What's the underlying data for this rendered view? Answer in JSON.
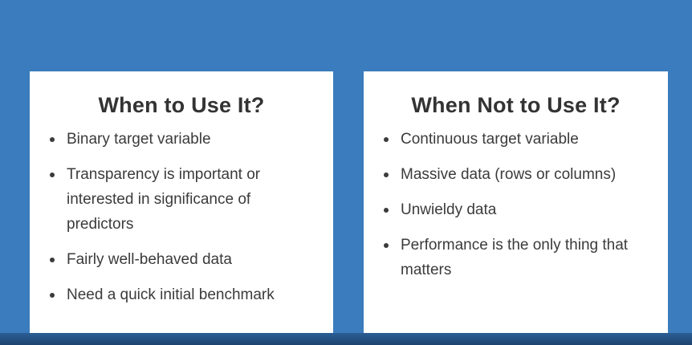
{
  "left_card": {
    "title": "When to Use It?",
    "items": [
      "Binary target variable",
      "Transparency is important or interested in significance of predictors",
      "Fairly well-behaved data",
      "Need a quick initial benchmark"
    ]
  },
  "right_card": {
    "title": "When Not to Use It?",
    "items": [
      "Continuous target variable",
      "Massive data (rows or columns)",
      "Unwieldy data",
      "Performance is the only thing that matters"
    ]
  },
  "colors": {
    "background": "#3a7cbd",
    "card": "#ffffff",
    "text": "#333333"
  }
}
